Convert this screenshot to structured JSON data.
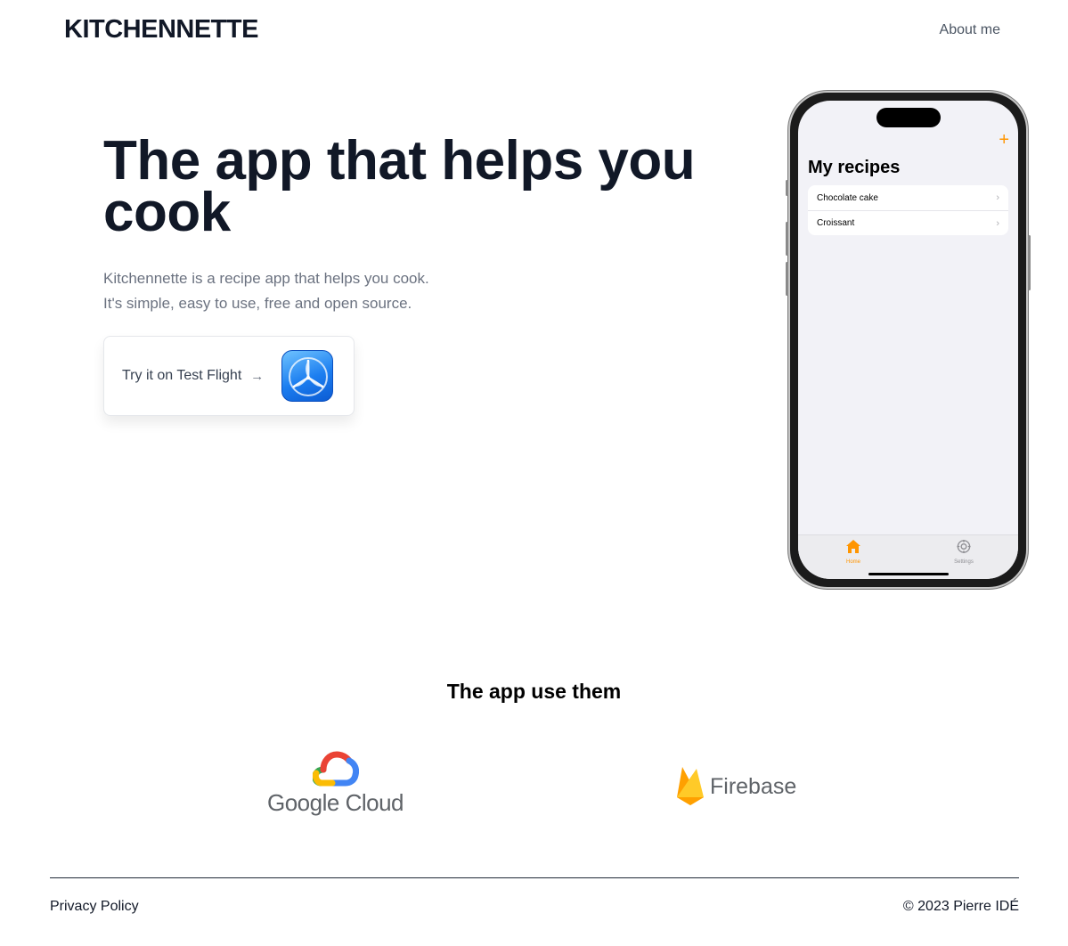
{
  "header": {
    "brand": "KITCHENNETTE",
    "nav_about": "About me"
  },
  "hero": {
    "title": "The app that helps you cook",
    "text_line1": "Kitchennette is a recipe app that helps you cook.",
    "text_line2": "It's simple, easy to use, free and open source.",
    "cta_label": "Try it on Test Flight",
    "cta_arrow": "→"
  },
  "phone": {
    "add_symbol": "+",
    "nav_title": "My recipes",
    "recipes": [
      "Chocolate cake",
      "Croissant"
    ],
    "chevron": "›",
    "tabs": [
      {
        "label": "Home",
        "icon": "house-icon"
      },
      {
        "label": "Settings",
        "icon": "gear-icon"
      }
    ],
    "accent_color": "#ff9500"
  },
  "tech": {
    "title": "The app use them",
    "logos": [
      {
        "name": "Google Cloud",
        "icon": "google-cloud-icon"
      },
      {
        "name": "Firebase",
        "icon": "firebase-flame-icon"
      }
    ]
  },
  "footer": {
    "privacy_label": "Privacy Policy",
    "copyright": "© 2023 Pierre IDÉ"
  }
}
